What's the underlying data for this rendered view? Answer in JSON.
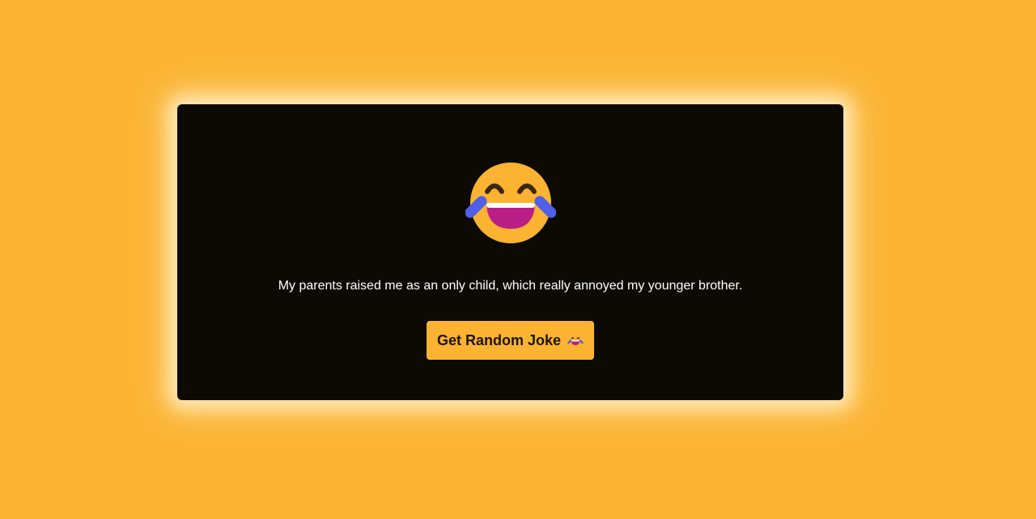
{
  "joke": {
    "text": "My parents raised me as an only child, which really annoyed my younger brother."
  },
  "emoji": {
    "icon": "face-with-tears-of-joy-icon",
    "face_color": "#fbb331",
    "tear_color": "#4f5fe8",
    "mouth_color": "#b91e86"
  },
  "button": {
    "label": "Get Random Joke",
    "icon": "face-with-tears-of-joy-icon"
  },
  "colors": {
    "background": "#fbb331",
    "card": "#0c0a02",
    "button_text": "#1b1406"
  }
}
